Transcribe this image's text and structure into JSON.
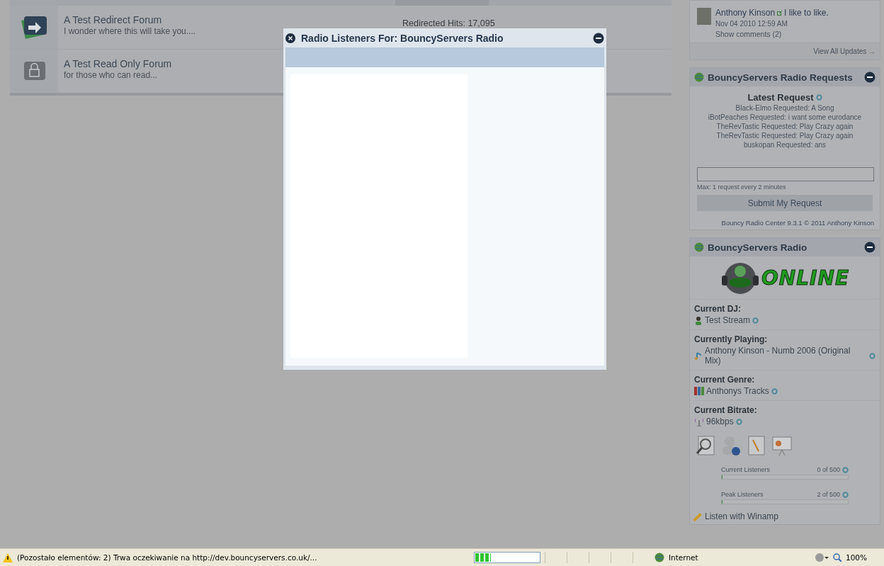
{
  "forums": [
    {
      "kind": "redirect",
      "title": "A Test Redirect Forum",
      "description": "I wonder where this will take you....",
      "stat": "Redirected Hits: 17,095"
    },
    {
      "kind": "readonly",
      "title": "A Test Read Only Forum",
      "description": "for those who can read..."
    }
  ],
  "modal": {
    "title": "Radio Listeners For: BouncyServers Radio"
  },
  "status_update": {
    "author": "Anthony Kinson",
    "text": "I like to like.",
    "date": "Nov 04 2010 12:59 AM",
    "comments": "Show comments (2)",
    "view_all": "View All Updates →"
  },
  "requests": {
    "title": "BouncyServers Radio Requests",
    "heading": "Latest Request",
    "items": [
      {
        "user": "Black-Elmo",
        "text": "Requested: A Song"
      },
      {
        "user": "iBotPeaches",
        "text": "Requested: i want some eurodance"
      },
      {
        "user": "TheRevTastic",
        "text": "Requested: Play Crazy again"
      },
      {
        "user": "TheRevTastic",
        "text": "Requested: Play Crazy again"
      },
      {
        "user": "buskopan",
        "text": "Requested: ans"
      }
    ],
    "hint": "Max: 1 request every 2 minutes",
    "submit": "Submit My Request",
    "footer": "Bouncy Radio Center 9.3.1 © 2011  Anthony Kinson"
  },
  "radio": {
    "title": "BouncyServers Radio",
    "logo_text": "ONLINE",
    "info": [
      {
        "kind": "dj",
        "label": "Current DJ:",
        "value": "Test Stream"
      },
      {
        "kind": "song",
        "label": "Currently Playing:",
        "value": "Anthony Kinson - Numb 2006 (Original Mix)"
      },
      {
        "kind": "genre",
        "label": "Current Genre:",
        "value": "Anthonys Tracks"
      },
      {
        "kind": "bitrate",
        "label": "Current Bitrate:",
        "value": "96kbps"
      }
    ],
    "listeners": [
      {
        "label": "Current Listeners",
        "reading": "0 of 500",
        "level": 0
      },
      {
        "label": "Peak Listeners",
        "reading": "2 of 500",
        "level": 0.004
      }
    ],
    "winamp": "Listen with Winamp"
  },
  "status_bar": {
    "message": "(Pozostało elementów: 2) Trwa oczekiwanie na http://dev.bouncyservers.co.uk/...",
    "level": 0.25,
    "zone": "Internet",
    "zoom": "100%"
  }
}
